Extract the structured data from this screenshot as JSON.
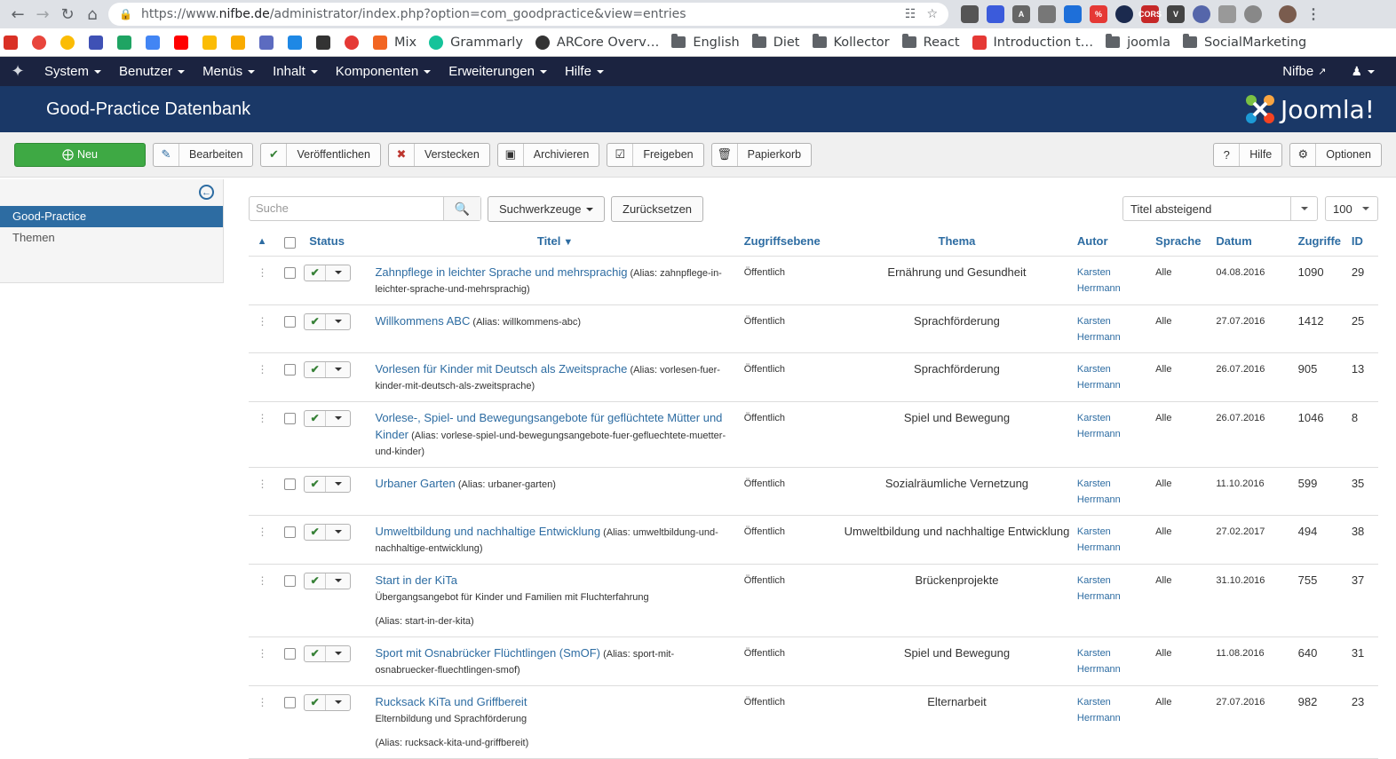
{
  "browser": {
    "url_prefix": "https://www.",
    "url_domain": "nifbe.de",
    "url_path": "/administrator/index.php?option=com_goodpractice&view=entries",
    "bookmarks": [
      {
        "label": "Mix",
        "color": "#f26522"
      },
      {
        "label": "Grammarly",
        "color": "#15c39a"
      },
      {
        "label": "ARCore Overv…",
        "color": "#333333"
      },
      {
        "label": "English",
        "folder": true
      },
      {
        "label": "Diet",
        "folder": true
      },
      {
        "label": "Kollector",
        "folder": true
      },
      {
        "label": "React",
        "folder": true
      },
      {
        "label": "Introduction t…",
        "color": "#e53935"
      },
      {
        "label": "joomla",
        "folder": true
      },
      {
        "label": "SocialMarketing",
        "folder": true
      }
    ]
  },
  "nav": {
    "menus": [
      "System",
      "Benutzer",
      "Menüs",
      "Inhalt",
      "Komponenten",
      "Erweiterungen",
      "Hilfe"
    ],
    "site_link": "Nifbe",
    "user_icon": "user-icon"
  },
  "header": {
    "title": "Good-Practice Datenbank",
    "brand": "Joomla!"
  },
  "toolbar": {
    "new": "Neu",
    "edit": "Bearbeiten",
    "publish": "Veröffentlichen",
    "unpublish": "Verstecken",
    "archive": "Archivieren",
    "checkin": "Freigeben",
    "trash": "Papierkorb",
    "help": "Hilfe",
    "options": "Optionen"
  },
  "sidebar": {
    "items": [
      "Good-Practice",
      "Themen"
    ]
  },
  "filters": {
    "search_placeholder": "Suche",
    "tools": "Suchwerkzeuge",
    "reset": "Zurücksetzen",
    "sort": "Titel absteigend",
    "limit": "100"
  },
  "table": {
    "headers": {
      "status": "Status",
      "title": "Titel",
      "access": "Zugriffsebene",
      "theme": "Thema",
      "author": "Autor",
      "language": "Sprache",
      "date": "Datum",
      "hits": "Zugriffe",
      "id": "ID"
    },
    "rows": [
      {
        "title": "Zahnpflege in leichter Sprache und mehrsprachig",
        "subtitle": "",
        "alias": "(Alias: zahnpflege-in-leichter-sprache-und-mehrsprachig)",
        "access": "Öffentlich",
        "theme": "Ernährung und Gesundheit",
        "author1": "Karsten",
        "author2": "Herrmann",
        "lang": "Alle",
        "date": "04.08.2016",
        "hits": "1090",
        "id": "29"
      },
      {
        "title": "Willkommens ABC",
        "subtitle": "",
        "alias": "(Alias: willkommens-abc)",
        "access": "Öffentlich",
        "theme": "Sprachförderung",
        "author1": "Karsten",
        "author2": "Herrmann",
        "lang": "Alle",
        "date": "27.07.2016",
        "hits": "1412",
        "id": "25"
      },
      {
        "title": "Vorlesen für Kinder mit Deutsch als Zweitsprache",
        "subtitle": "",
        "alias": "(Alias: vorlesen-fuer-kinder-mit-deutsch-als-zweitsprache)",
        "access": "Öffentlich",
        "theme": "Sprachförderung",
        "author1": "Karsten",
        "author2": "Herrmann",
        "lang": "Alle",
        "date": "26.07.2016",
        "hits": "905",
        "id": "13"
      },
      {
        "title": "Vorlese-, Spiel- und Bewegungsangebote für geflüchtete Mütter und Kinder",
        "subtitle": "",
        "alias": "(Alias: vorlese-spiel-und-bewegungsangebote-fuer-gefluechtete-muetter-und-kinder)",
        "access": "Öffentlich",
        "theme": "Spiel und Bewegung",
        "author1": "Karsten",
        "author2": "Herrmann",
        "lang": "Alle",
        "date": "26.07.2016",
        "hits": "1046",
        "id": "8"
      },
      {
        "title": "Urbaner Garten",
        "subtitle": "",
        "alias": "(Alias: urbaner-garten)",
        "access": "Öffentlich",
        "theme": "Sozialräumliche Vernetzung",
        "author1": "Karsten",
        "author2": "Herrmann",
        "lang": "Alle",
        "date": "11.10.2016",
        "hits": "599",
        "id": "35"
      },
      {
        "title": "Umweltbildung und nachhaltige Entwicklung",
        "subtitle": "",
        "alias": "(Alias: umweltbildung-und-nachhaltige-entwicklung)",
        "access": "Öffentlich",
        "theme": "Umweltbildung und nachhaltige Entwicklung",
        "author1": "Karsten",
        "author2": "Herrmann",
        "lang": "Alle",
        "date": "27.02.2017",
        "hits": "494",
        "id": "38"
      },
      {
        "title": "Start in der KiTa",
        "subtitle": "Übergangsangebot für Kinder und Familien mit Fluchterfahrung",
        "alias": "(Alias: start-in-der-kita)",
        "access": "Öffentlich",
        "theme": "Brückenprojekte",
        "author1": "Karsten",
        "author2": "Herrmann",
        "lang": "Alle",
        "date": "31.10.2016",
        "hits": "755",
        "id": "37"
      },
      {
        "title": "Sport mit Osnabrücker Flüchtlingen (SmOF)",
        "subtitle": "",
        "alias": "(Alias: sport-mit-osnabruecker-fluechtlingen-smof)",
        "access": "Öffentlich",
        "theme": "Spiel und Bewegung",
        "author1": "Karsten",
        "author2": "Herrmann",
        "lang": "Alle",
        "date": "11.08.2016",
        "hits": "640",
        "id": "31"
      },
      {
        "title": "Rucksack KiTa und Griffbereit",
        "subtitle": "Elternbildung und Sprachförderung",
        "alias": "(Alias: rucksack-kita-und-griffbereit)",
        "access": "Öffentlich",
        "theme": "Elternarbeit",
        "author1": "Karsten",
        "author2": "Herrmann",
        "lang": "Alle",
        "date": "27.07.2016",
        "hits": "982",
        "id": "23"
      }
    ]
  }
}
